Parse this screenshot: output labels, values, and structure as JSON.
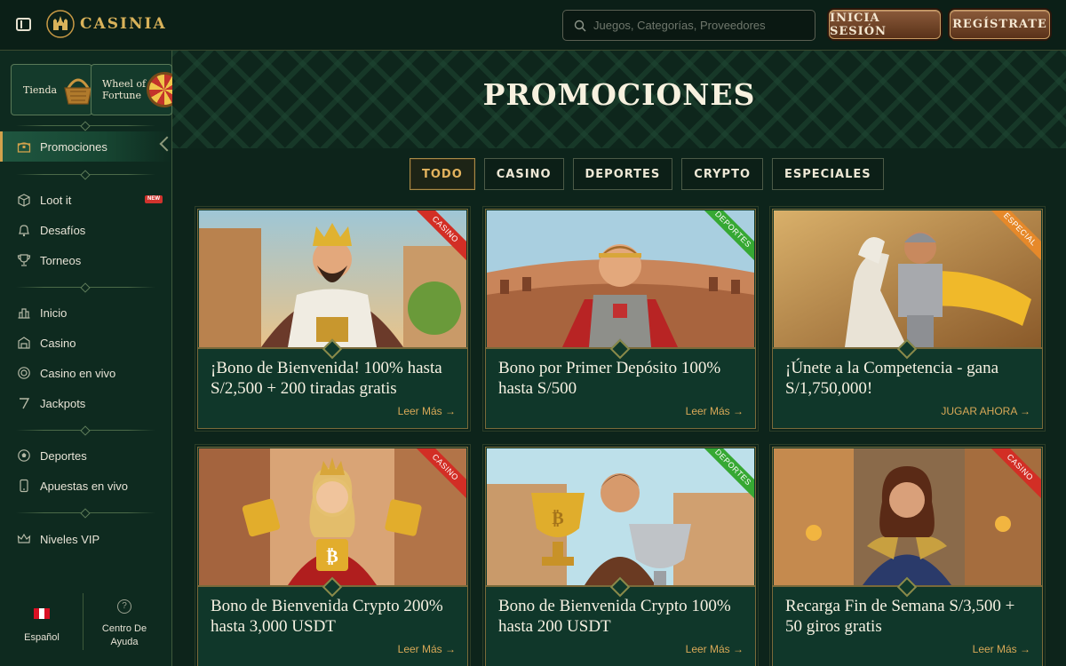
{
  "header": {
    "brand": "CASINIA",
    "search_placeholder": "Juegos, Categorías, Proveedores",
    "login_label": "INICIA SESIÓN",
    "register_label": "REGÍSTRATE"
  },
  "sidebar": {
    "quick": [
      {
        "label": "Tienda",
        "icon": "basket-icon"
      },
      {
        "label": "Wheel of Fortune",
        "icon": "wheel-icon"
      }
    ],
    "groups": [
      [
        {
          "label": "Promociones",
          "icon": "chest-icon",
          "active": true
        }
      ],
      [
        {
          "label": "Loot it",
          "icon": "box-icon",
          "badge": "NEW"
        },
        {
          "label": "Desafíos",
          "icon": "bell-icon"
        },
        {
          "label": "Torneos",
          "icon": "trophy-icon"
        }
      ],
      [
        {
          "label": "Inicio",
          "icon": "home-icon"
        },
        {
          "label": "Casino",
          "icon": "casino-icon"
        },
        {
          "label": "Casino en vivo",
          "icon": "chip-icon"
        },
        {
          "label": "Jackpots",
          "icon": "seven-icon"
        }
      ],
      [
        {
          "label": "Deportes",
          "icon": "ball-icon"
        },
        {
          "label": "Apuestas en vivo",
          "icon": "phone-icon"
        }
      ],
      [
        {
          "label": "Niveles VIP",
          "icon": "crown-icon"
        }
      ]
    ],
    "language": "Español",
    "help": "Centro De Ayuda",
    "flag_colors": [
      "#d91023",
      "#ffffff",
      "#d91023"
    ]
  },
  "main": {
    "title": "PROMOCIONES",
    "tabs": [
      "TODO",
      "CASINO",
      "DEPORTES",
      "CRYPTO",
      "ESPECIALES"
    ],
    "active_tab": "TODO",
    "cards": [
      {
        "tag": "CASINO",
        "tag_type": "casino",
        "title": "¡Bono de Bienvenida! 100% hasta S/2,500 + 200 tiradas gratis",
        "link": "Leer Más →",
        "scene": "king"
      },
      {
        "tag": "DEPORTES",
        "tag_type": "deportes",
        "title": "Bono por Primer Depósito 100% hasta S/500",
        "link": "Leer Más →",
        "scene": "gladiator"
      },
      {
        "tag": "ESPECIAL",
        "tag_type": "especial",
        "title": "¡Únete a la Competencia - gana S/1,750,000!",
        "link": "JUGAR AHORA →",
        "scene": "knight"
      },
      {
        "tag": "CASINO",
        "tag_type": "casino",
        "title": "Bono de Bienvenida Crypto 200% hasta 3,000 USDT",
        "link": "Leer Más →",
        "scene": "queen"
      },
      {
        "tag": "DEPORTES",
        "tag_type": "deportes",
        "title": "Bono de Bienvenida Crypto 100% hasta 200 USDT",
        "link": "Leer Más →",
        "scene": "trophy"
      },
      {
        "tag": "CASINO",
        "tag_type": "casino",
        "title": "Recarga Fin de Semana S/3,500 + 50 giros gratis",
        "link": "Leer Más →",
        "scene": "heroine"
      }
    ]
  }
}
